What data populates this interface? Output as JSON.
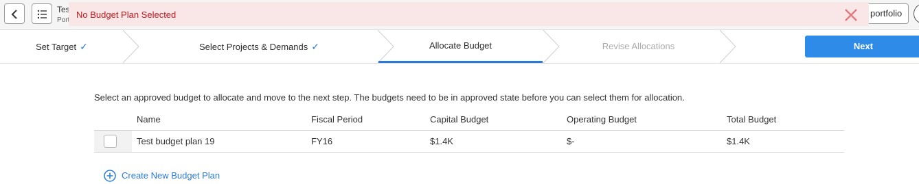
{
  "header": {
    "record_title": "Test",
    "record_subtitle": "Portfolio",
    "portfolio_button_label": "portfolio",
    "back_icon": "chevron-left-icon",
    "list_icon": "list-icon"
  },
  "error_banner": {
    "message": "No Budget Plan Selected",
    "close_icon": "close-x-icon",
    "color": "#c0181e"
  },
  "wizard": {
    "steps": [
      {
        "label": "Set Target",
        "state": "complete"
      },
      {
        "label": "Select Projects & Demands",
        "state": "complete"
      },
      {
        "label": "Allocate Budget",
        "state": "active"
      },
      {
        "label": "Revise Allocations",
        "state": "disabled"
      }
    ],
    "check_glyph": "✓",
    "next_label": "Next",
    "accent_color": "#2b7bd6"
  },
  "content": {
    "instructions": "Select an approved budget to allocate and move to the next step. The budgets need to be in approved state before you can select them for allocation.",
    "table": {
      "columns": [
        "Name",
        "Fiscal Period",
        "Capital Budget",
        "Operating Budget",
        "Total Budget"
      ],
      "rows": [
        {
          "name": "Test budget plan 19",
          "fiscal_period": "FY16",
          "capital_budget": "$1.4K",
          "operating_budget": "$-",
          "total_budget": "$1.4K",
          "selected": false
        }
      ]
    },
    "create_link": "Create New Budget Plan"
  }
}
